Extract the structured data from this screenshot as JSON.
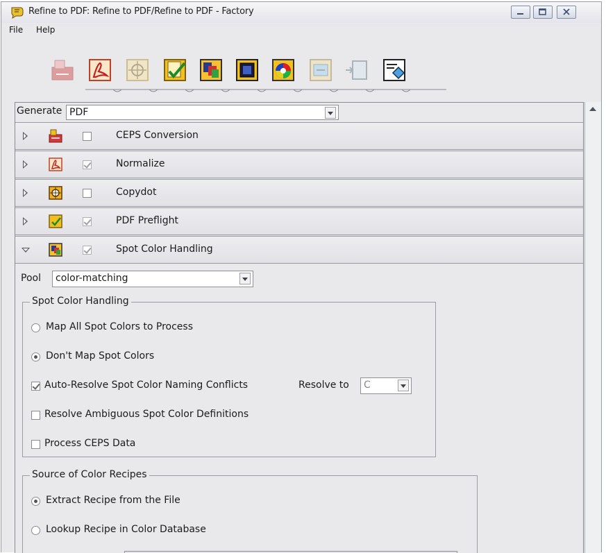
{
  "window": {
    "title": "Refine to PDF: Refine to PDF/Refine to PDF - Factory",
    "controls": {
      "minimize": "minimize-icon",
      "maximize": "maximize-icon",
      "close": "close-icon"
    }
  },
  "menubar": {
    "items": [
      {
        "label": "File"
      },
      {
        "label": "Help"
      }
    ]
  },
  "toolbar": {
    "buttons": [
      {
        "icon": "ceps-conversion-icon",
        "enabled": false
      },
      {
        "icon": "normalize-icon",
        "enabled": true
      },
      {
        "icon": "copydot-icon",
        "enabled": false
      },
      {
        "icon": "pdf-preflight-icon",
        "enabled": true
      },
      {
        "icon": "spot-color-icon",
        "enabled": true
      },
      {
        "icon": "frame-icon",
        "enabled": true
      },
      {
        "icon": "color-wheel-icon",
        "enabled": true
      },
      {
        "icon": "imposition-icon",
        "enabled": false
      },
      {
        "icon": "page-insert-icon",
        "enabled": false
      },
      {
        "icon": "output-icon",
        "enabled": true
      }
    ]
  },
  "generate": {
    "label": "Generate",
    "value": "PDF"
  },
  "sections": [
    {
      "label": "CEPS Conversion",
      "checked": false,
      "expanded": false
    },
    {
      "label": "Normalize",
      "checked": true,
      "expanded": false
    },
    {
      "label": "Copydot",
      "checked": false,
      "expanded": false
    },
    {
      "label": "PDF Preflight",
      "checked": true,
      "expanded": false
    },
    {
      "label": "Spot Color Handling",
      "checked": true,
      "expanded": true
    }
  ],
  "pool": {
    "label": "Pool",
    "value": "color-matching"
  },
  "spot_color_handling": {
    "legend": "Spot Color Handling",
    "map_all": "Map All Spot Colors to Process",
    "dont_map": "Don't Map Spot Colors",
    "selected": "dont_map",
    "auto_resolve": {
      "label": "Auto-Resolve Spot Color Naming Conflicts",
      "checked": true
    },
    "resolve_to": {
      "label": "Resolve to",
      "value": "C"
    },
    "resolve_ambiguous": {
      "label": "Resolve Ambiguous Spot Color Definitions",
      "checked": false
    },
    "process_ceps": {
      "label": "Process CEPS Data",
      "checked": false
    }
  },
  "source_of_color_recipes": {
    "legend": "Source of Color Recipes",
    "extract": "Extract Recipe from the File",
    "lookup": "Lookup Recipe in Color Database",
    "selected": "extract"
  },
  "colors": {
    "window_bg": "#e9e9eb",
    "border": "#9a9aa2",
    "field_bg": "#ffffff"
  }
}
